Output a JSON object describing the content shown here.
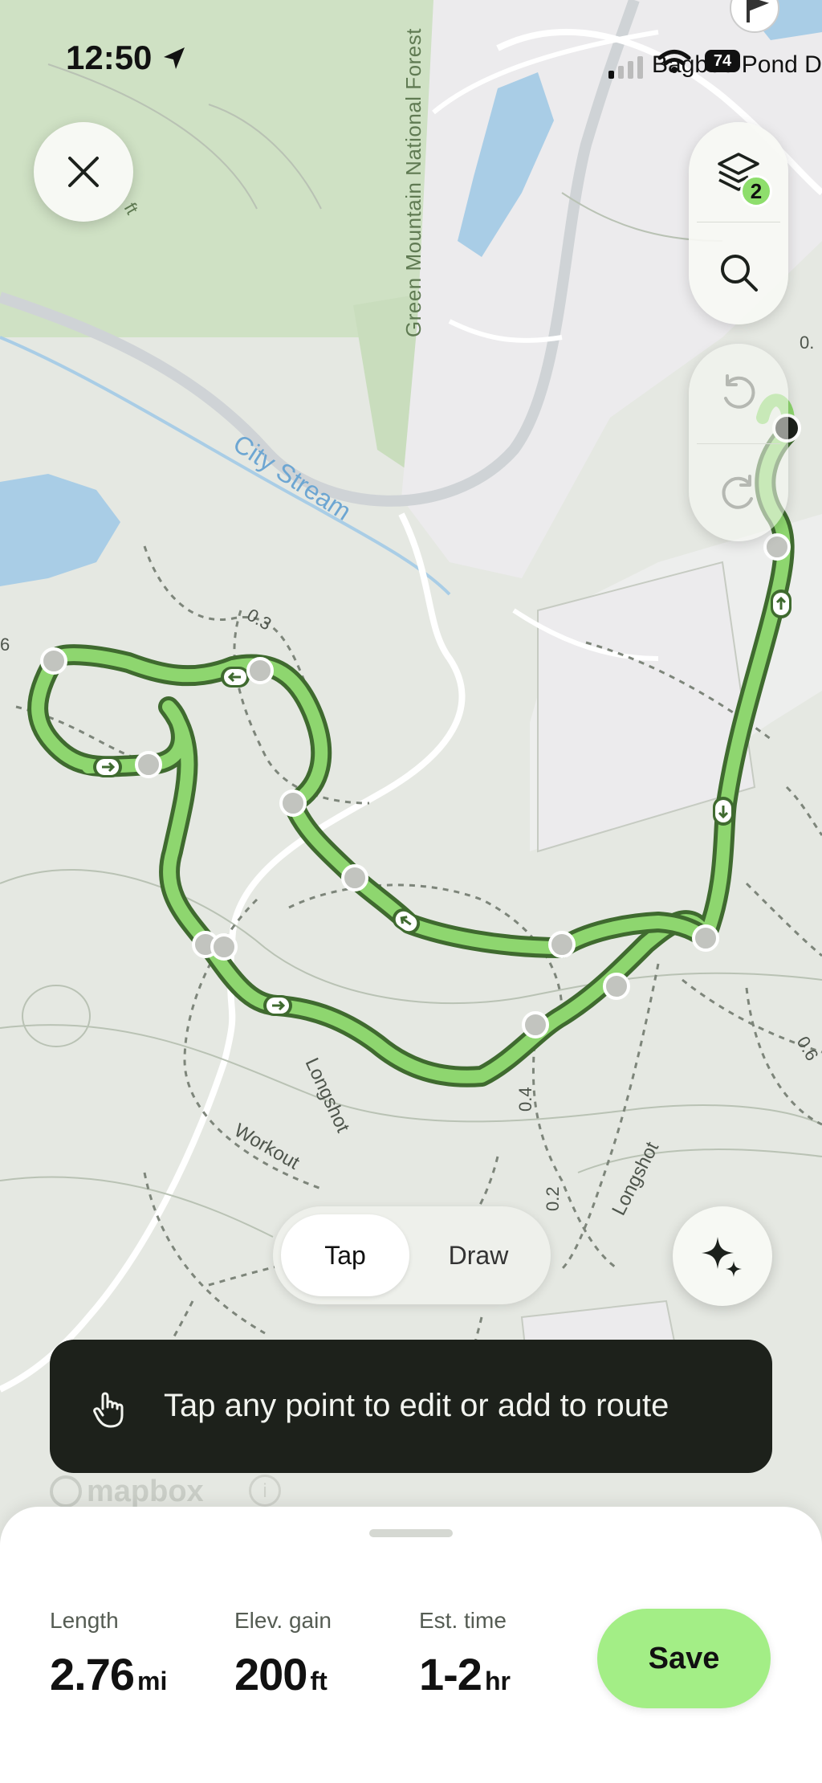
{
  "status_bar": {
    "time": "12:50",
    "place": "Bagbee Pond D",
    "battery": "74"
  },
  "map": {
    "labels": {
      "forest": "Green Mountain National Forest",
      "stream": "City Stream",
      "trail_longshot_1": "Longshot",
      "trail_longshot_2": "Longshot",
      "trail_workout": "Workout",
      "dist_03": "0.3",
      "dist_04": "0.4",
      "dist_02": "0.2",
      "dist_06": "0.6",
      "dist_6": "6",
      "dist_0": "0.",
      "ft": "ft"
    },
    "attribution": "mapbox",
    "info": "i"
  },
  "controls": {
    "close_icon": "close-icon",
    "layers_icon": "layers-icon",
    "layers_count": "2",
    "search_icon": "search-icon",
    "undo_icon": "undo-icon",
    "redo_icon": "redo-icon",
    "ai_icon": "sparkle-icon"
  },
  "mode_toggle": {
    "tap_label": "Tap",
    "draw_label": "Draw",
    "selected": "Tap"
  },
  "toast": {
    "text": "Tap any point to edit or add to route",
    "icon": "hand-pointer-icon"
  },
  "stats": {
    "length": {
      "label": "Length",
      "value": "2.76",
      "unit": "mi"
    },
    "elevation": {
      "label": "Elev. gain",
      "value": "200",
      "unit": "ft"
    },
    "time": {
      "label": "Est. time",
      "value": "1-2",
      "unit": "hr"
    }
  },
  "save_label": "Save",
  "colors": {
    "route_fill": "#8ed66f",
    "route_outline": "#3f6a2f",
    "save_button": "#a3ee86",
    "forest": "#cfe1c4",
    "water": "#a9cde6",
    "toast_bg": "#1d211b"
  }
}
